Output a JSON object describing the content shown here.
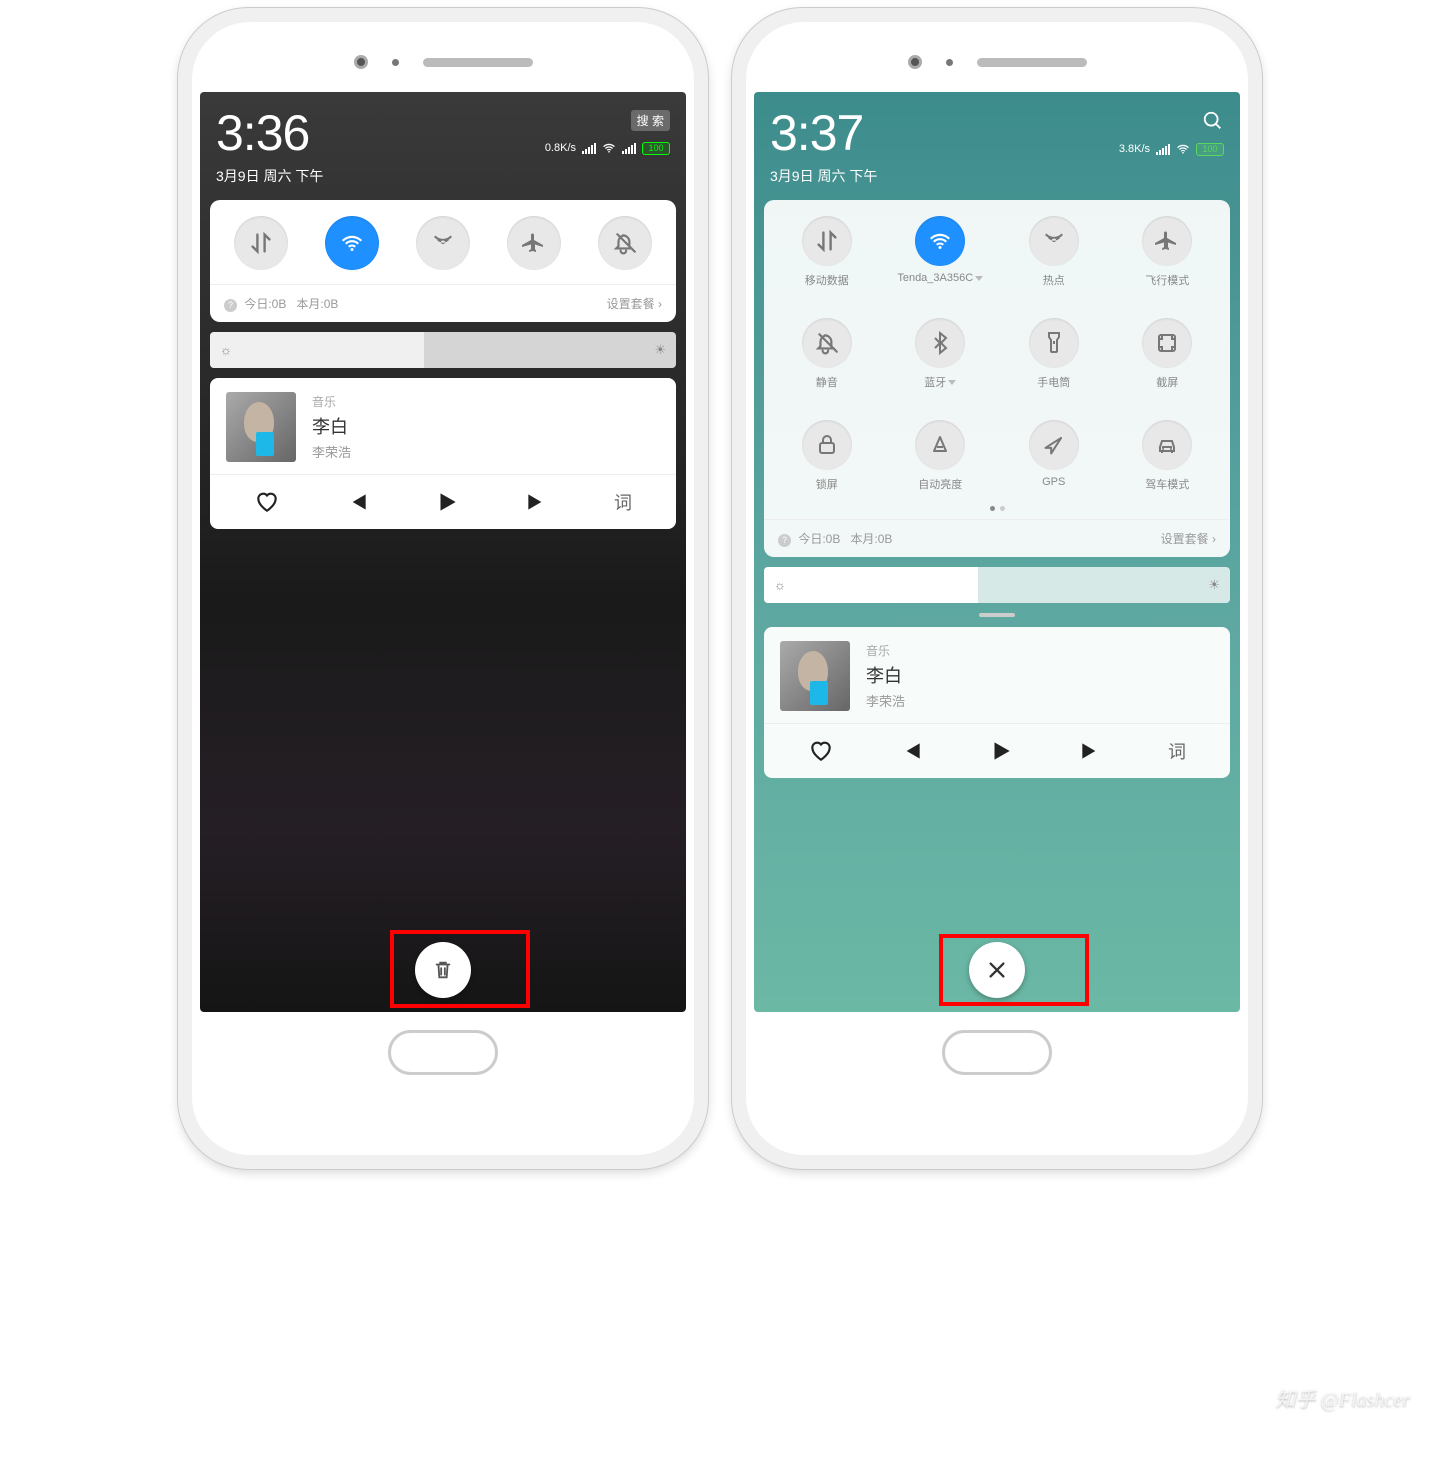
{
  "left": {
    "time": "3:36",
    "date": "3月9日 周六 下午",
    "search_pill": "搜 索",
    "net_speed": "0.8K/s",
    "battery": "100",
    "toggles": [
      {
        "name": "data",
        "label": ""
      },
      {
        "name": "wifi",
        "label": "",
        "active": true
      },
      {
        "name": "hotspot",
        "label": ""
      },
      {
        "name": "airplane",
        "label": ""
      },
      {
        "name": "mute",
        "label": ""
      }
    ],
    "data_today": "今日:0B",
    "data_month": "本月:0B",
    "plan_link": "设置套餐 ›",
    "music": {
      "source": "音乐",
      "title": "李白",
      "artist": "李荣浩",
      "lyric_btn": "词"
    }
  },
  "right": {
    "time": "3:37",
    "date": "3月9日 周六 下午",
    "net_speed": "3.8K/s",
    "battery": "100",
    "toggles_row1": [
      {
        "name": "data",
        "label": "移动数据"
      },
      {
        "name": "wifi",
        "label": "Tenda_3A356C",
        "active": true,
        "dropdown": true
      },
      {
        "name": "hotspot",
        "label": "热点"
      },
      {
        "name": "airplane",
        "label": "飞行模式"
      }
    ],
    "toggles_row2": [
      {
        "name": "mute",
        "label": "静音"
      },
      {
        "name": "bluetooth",
        "label": "蓝牙",
        "dropdown": true
      },
      {
        "name": "flashlight",
        "label": "手电筒"
      },
      {
        "name": "screenshot",
        "label": "截屏"
      }
    ],
    "toggles_row3": [
      {
        "name": "lock",
        "label": "锁屏"
      },
      {
        "name": "autobright",
        "label": "自动亮度"
      },
      {
        "name": "gps",
        "label": "GPS"
      },
      {
        "name": "drive",
        "label": "驾车模式"
      }
    ],
    "data_today": "今日:0B",
    "data_month": "本月:0B",
    "plan_link": "设置套餐 ›",
    "music": {
      "source": "音乐",
      "title": "李白",
      "artist": "李荣浩",
      "lyric_btn": "词"
    }
  },
  "watermark": "知乎 @Flashcer"
}
